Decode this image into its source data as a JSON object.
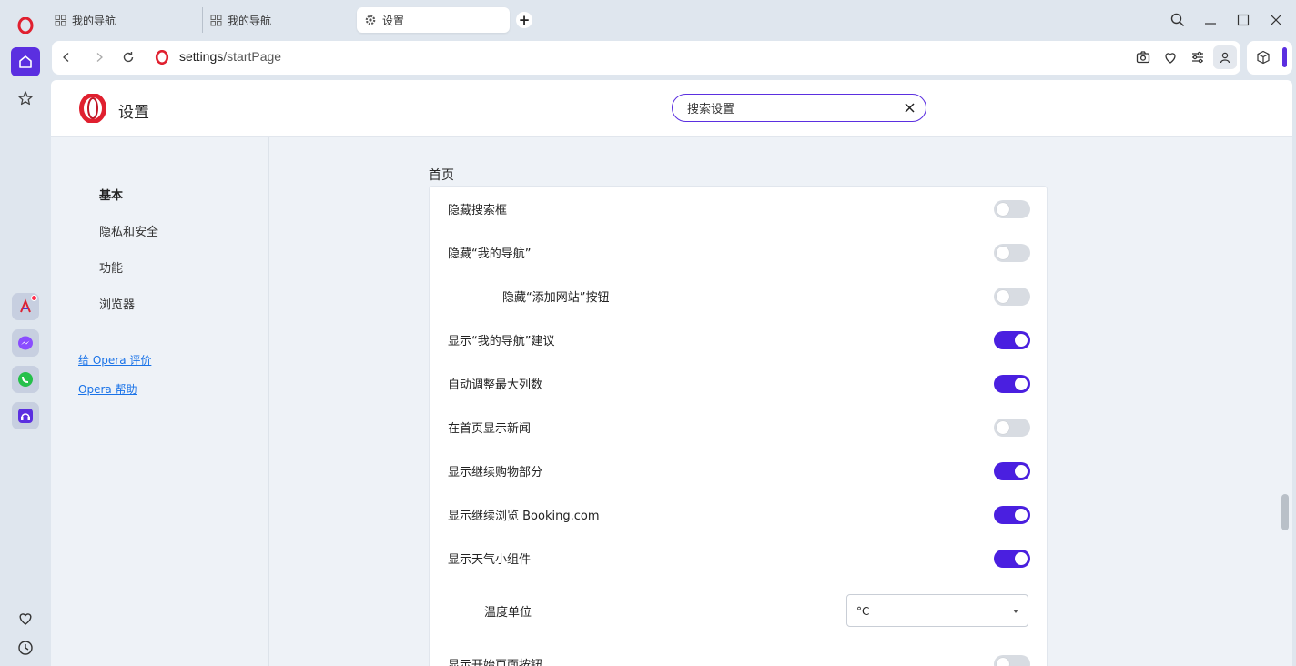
{
  "tabs": [
    {
      "title": "我的导航",
      "icon": "grid-icon"
    },
    {
      "title": "我的导航",
      "icon": "grid-icon"
    },
    {
      "title": "设置",
      "icon": "gear-icon"
    }
  ],
  "address": {
    "host": "settings",
    "path": "/startPage"
  },
  "settings": {
    "title": "设置",
    "search_value": "搜索设置"
  },
  "nav": {
    "items": [
      "基本",
      "隐私和安全",
      "功能",
      "浏览器"
    ],
    "links": [
      "给 Opera 评价",
      "Opera 帮助"
    ]
  },
  "section": {
    "title": "首页",
    "rows": [
      {
        "label": "隐藏搜索框",
        "on": false
      },
      {
        "label": "隐藏“我的导航”",
        "on": false
      },
      {
        "label": "隐藏“添加网站”按钮",
        "on": false
      },
      {
        "label": "显示“我的导航”建议",
        "on": true
      },
      {
        "label": "自动调整最大列数",
        "on": true
      },
      {
        "label": "在首页显示新闻",
        "on": false
      },
      {
        "label": "显示继续购物部分",
        "on": true
      },
      {
        "label": "显示继续浏览 Booking.com",
        "on": true
      },
      {
        "label": "显示天气小组件",
        "on": true
      }
    ],
    "temperature": {
      "label": "温度单位",
      "value": "°C"
    },
    "last_row": {
      "label": "显示开始页面按钮",
      "on": false
    }
  },
  "colors": {
    "accent": "#4a1fe0",
    "opera_red": "#e0202f"
  }
}
